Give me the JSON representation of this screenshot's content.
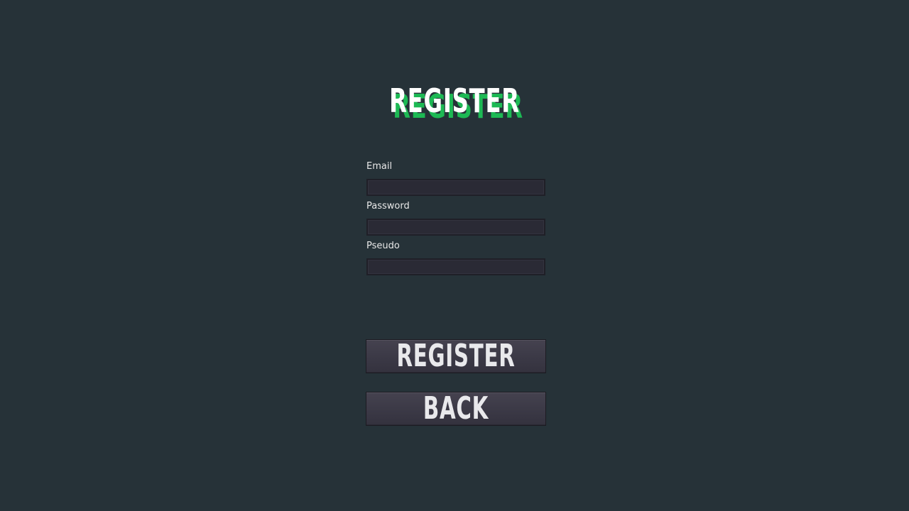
{
  "title": "REGISTER",
  "form": {
    "email_label": "Email",
    "email_value": "",
    "password_label": "Password",
    "password_value": "",
    "pseudo_label": "Pseudo",
    "pseudo_value": ""
  },
  "buttons": {
    "register_label": "REGISTER",
    "back_label": "BACK"
  },
  "colors": {
    "background": "#263238",
    "title_shadow": "#1db954",
    "title_main": "#ffffff",
    "button": "#3b3946",
    "input": "#2a2a35"
  }
}
